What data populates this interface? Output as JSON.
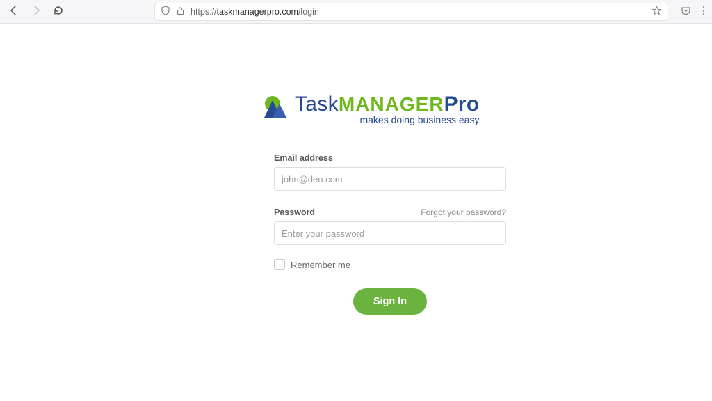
{
  "browser": {
    "url_prefix": "https://",
    "url_domain": "taskmanagerpro.com",
    "url_path": "/login"
  },
  "logo": {
    "word_task": "Task",
    "word_manager": "MANAGER",
    "word_pro": "Pro",
    "tagline": "makes doing business easy"
  },
  "form": {
    "email_label": "Email address",
    "email_placeholder": "john@deo.com",
    "password_label": "Password",
    "password_placeholder": "Enter your password",
    "forgot_label": "Forgot your password?",
    "remember_label": "Remember me",
    "signin_label": "Sign In"
  }
}
